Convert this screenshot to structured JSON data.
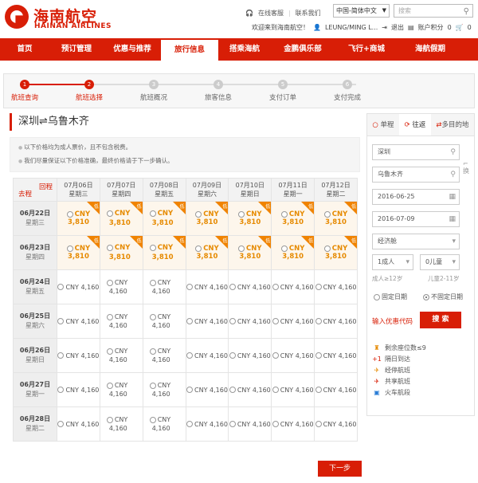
{
  "brand": {
    "name_cn": "海南航空",
    "name_en": "HAINAN AIRLINES"
  },
  "top": {
    "service": "在线客服",
    "contact": "联系我们",
    "lang": "中国-简体中文",
    "search_placeholder": "搜索",
    "welcome": "欢迎来到海南航空！",
    "user": "LEUNG/MING L...",
    "logout": "退出",
    "points": "账户积分",
    "points_value": "0",
    "cart_count": "0"
  },
  "nav": [
    "首页",
    "预订管理",
    "优惠与推荐",
    "旅行信息",
    "搭乘海航",
    "金鹏俱乐部",
    "飞行+商城",
    "海航假期"
  ],
  "steps": [
    "航班查询",
    "航班选择",
    "航班概况",
    "旅客信息",
    "支付订单",
    "支付完成"
  ],
  "route_title": "深圳⇌乌鲁木齐",
  "notes": [
    "以下价格均为成人票价，且不包含税费。",
    "我们尽量保证以下价格准确，最终价格请于下一步确认。"
  ],
  "grid": {
    "back_label": "回程",
    "go_label": "去程",
    "low_tag": "低",
    "price_low": "CNY 3,810",
    "price": "CNY 4,160",
    "cny": "CNY",
    "amount": "4,160",
    "amount_low": "3,810",
    "cols": [
      [
        "07月06日",
        "星期三"
      ],
      [
        "07月07日",
        "星期四"
      ],
      [
        "07月08日",
        "星期五"
      ],
      [
        "07月09日",
        "星期六"
      ],
      [
        "07月10日",
        "星期日"
      ],
      [
        "07月11日",
        "星期一"
      ],
      [
        "07月12日",
        "星期二"
      ]
    ],
    "rows": [
      [
        "06月22日",
        "星期三"
      ],
      [
        "06月23日",
        "星期四"
      ],
      [
        "06月24日",
        "星期五"
      ],
      [
        "06月25日",
        "星期六"
      ],
      [
        "06月26日",
        "星期日"
      ],
      [
        "06月27日",
        "星期一"
      ],
      [
        "06月28日",
        "星期二"
      ]
    ]
  },
  "side": {
    "tab1": "单程",
    "tab2": "往返",
    "tab3": "多目的地",
    "from": "深圳",
    "to": "乌鲁木齐",
    "swap": "换",
    "date1": "2016-06-25",
    "date2": "2016-07-09",
    "cabin": "经济舱",
    "adults": "1成人",
    "children": "0儿童",
    "adult_hint": "成人≥12岁",
    "child_hint": "儿童2-11岁",
    "fixed": "固定日期",
    "flexible": "不固定日期",
    "promo": "输入优惠代码",
    "search": "搜 索",
    "legend": [
      {
        "icon": "♜",
        "text": "剩余座位数≤9",
        "color": "#e68a00"
      },
      {
        "icon": "+1",
        "text": "隔日到达",
        "color": "#d81e06"
      },
      {
        "icon": "✈",
        "text": "经停航班",
        "color": "#e68a00"
      },
      {
        "icon": "✈",
        "text": "共享航班",
        "color": "#d81e06"
      },
      {
        "icon": "▣",
        "text": "火车航段",
        "color": "#2a7dd6"
      }
    ]
  },
  "next_label": "下一步"
}
